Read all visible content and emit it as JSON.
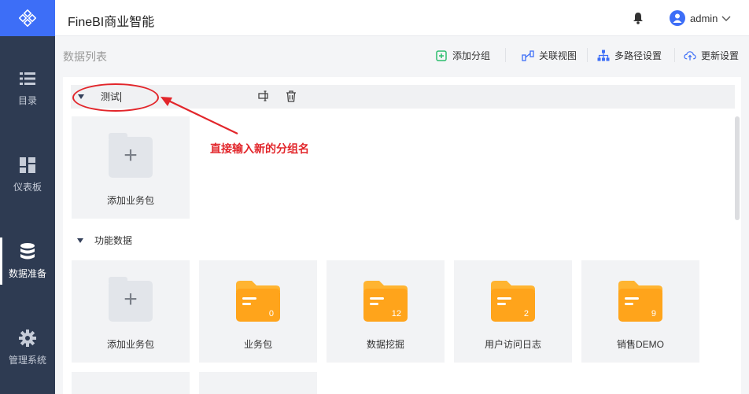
{
  "app": {
    "title": "FineBI商业智能",
    "user": "admin"
  },
  "sidebar": {
    "items": [
      {
        "label": "目录",
        "icon": "list-icon"
      },
      {
        "label": "仪表板",
        "icon": "dashboard-icon"
      },
      {
        "label": "数据准备",
        "icon": "database-icon",
        "active": true
      },
      {
        "label": "管理系统",
        "icon": "gear-icon"
      }
    ]
  },
  "header": {
    "title": "数据列表",
    "actions": [
      {
        "label": "添加分组",
        "icon": "add-group-icon"
      },
      {
        "label": "关联视图",
        "icon": "relation-view-icon"
      },
      {
        "label": "多路径设置",
        "icon": "multipath-icon"
      },
      {
        "label": "更新设置",
        "icon": "cloud-update-icon"
      }
    ]
  },
  "groups": [
    {
      "name": "测试",
      "editing": true,
      "packages": [
        {
          "name": "添加业务包",
          "type": "add"
        }
      ]
    },
    {
      "name": "功能数据",
      "packages": [
        {
          "name": "添加业务包",
          "type": "add"
        },
        {
          "name": "业务包",
          "count": "0"
        },
        {
          "name": "数据挖掘",
          "count": "12"
        },
        {
          "name": "用户访问日志",
          "count": "2"
        },
        {
          "name": "销售DEMO",
          "count": "9"
        }
      ]
    }
  ],
  "annotation": {
    "text": "直接输入新的分组名"
  },
  "colors": {
    "accent": "#3d6ef7",
    "sidebar": "#2e3b52",
    "folder": "#ffa41b",
    "annotation": "#e2262b"
  }
}
